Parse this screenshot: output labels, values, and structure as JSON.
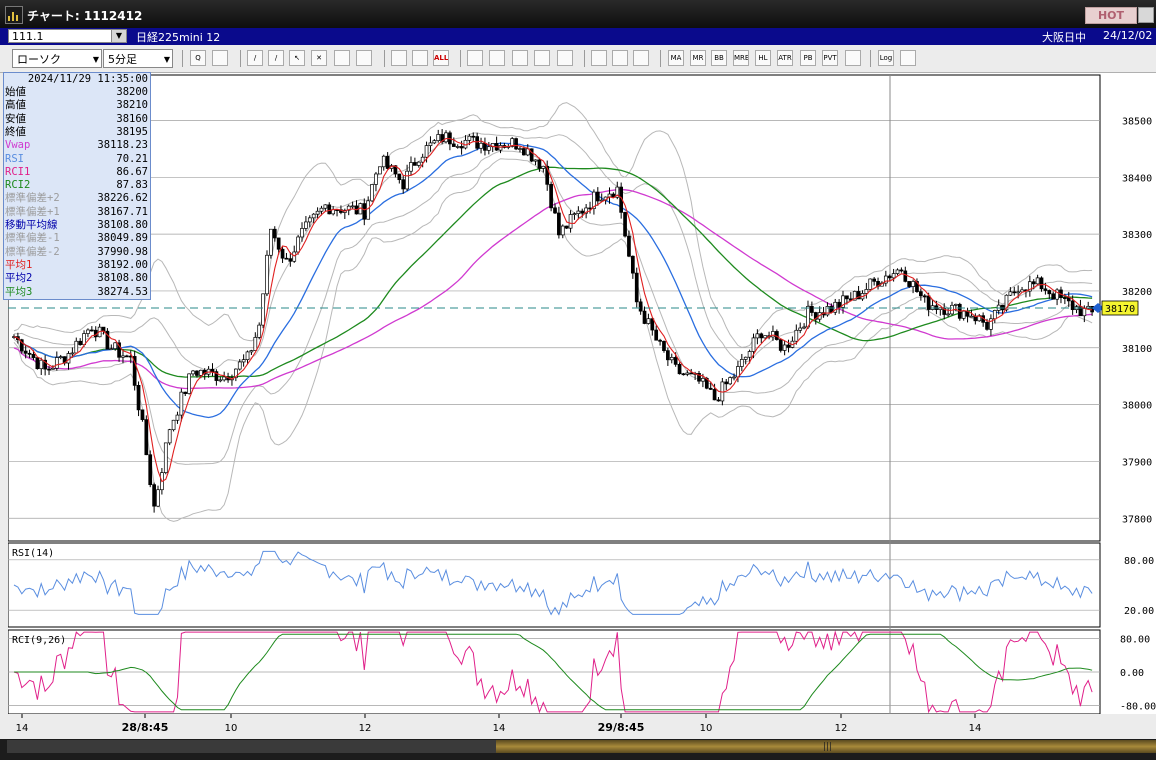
{
  "window": {
    "title": "チャート: 1112412",
    "hot_label": "HOT"
  },
  "infobar": {
    "symbol": "111.1",
    "product": "日経225mini 12",
    "market": "大阪日中",
    "date": "24/12/02"
  },
  "toolbar": {
    "chart_type": "ローソク",
    "interval": "5分足",
    "buttons": [
      {
        "name": "zoom-icon",
        "label": "Q"
      },
      {
        "name": "window-icon",
        "label": ""
      },
      {
        "name": "pencil-icon",
        "label": "/"
      },
      {
        "name": "line-draw-icon",
        "label": "/"
      },
      {
        "name": "cursor-icon",
        "label": "↖"
      },
      {
        "name": "erase-icon",
        "label": "✕"
      },
      {
        "name": "memo-icon",
        "label": ""
      },
      {
        "name": "trash-icon",
        "label": ""
      },
      {
        "name": "candle-add-icon",
        "label": ""
      },
      {
        "name": "candle-remove-icon",
        "label": ""
      },
      {
        "name": "all-button",
        "label": "ALL"
      },
      {
        "name": "volume-icon",
        "label": ""
      },
      {
        "name": "search-chart-icon",
        "label": ""
      },
      {
        "name": "panel-icon",
        "label": ""
      },
      {
        "name": "split-icon",
        "label": ""
      },
      {
        "name": "tick-icon",
        "label": ""
      },
      {
        "name": "settings-icon",
        "label": ""
      },
      {
        "name": "tools-icon",
        "label": ""
      },
      {
        "name": "color-icon",
        "label": ""
      },
      {
        "name": "ma-button",
        "label": "MA"
      },
      {
        "name": "mr-button",
        "label": "MR"
      },
      {
        "name": "bb-button",
        "label": "BB"
      },
      {
        "name": "mre-button",
        "label": "MRE"
      },
      {
        "name": "hl-button",
        "label": "HL"
      },
      {
        "name": "atr-button",
        "label": "ATR"
      },
      {
        "name": "pb-button",
        "label": "PB"
      },
      {
        "name": "pvt-button",
        "label": "PVT"
      },
      {
        "name": "frame-button",
        "label": ""
      },
      {
        "name": "log-button",
        "label": "Log"
      },
      {
        "name": "export-button",
        "label": ""
      }
    ]
  },
  "info_panel": {
    "timestamp": "2024/11/29 11:35:00",
    "rows": [
      {
        "label": "始値",
        "value": "38200",
        "color": "#000000"
      },
      {
        "label": "高値",
        "value": "38210",
        "color": "#000000"
      },
      {
        "label": "安値",
        "value": "38160",
        "color": "#000000"
      },
      {
        "label": "終値",
        "value": "38195",
        "color": "#000000"
      },
      {
        "label": "Vwap",
        "value": "38118.23",
        "color": "#d03ad0"
      },
      {
        "label": "RSI",
        "value": "70.21",
        "color": "#5a8ee0"
      },
      {
        "label": "RCI1",
        "value": "86.67",
        "color": "#e0208a"
      },
      {
        "label": "RCI2",
        "value": "87.83",
        "color": "#1e8a1e"
      },
      {
        "label": "標準偏差+2",
        "value": "38226.62",
        "color": "#9c9c9c"
      },
      {
        "label": "標準偏差+1",
        "value": "38167.71",
        "color": "#9c9c9c"
      },
      {
        "label": "移動平均線",
        "value": "38108.80",
        "color": "#0000aa"
      },
      {
        "label": "標準偏差-1",
        "value": "38049.89",
        "color": "#9c9c9c"
      },
      {
        "label": "標準偏差-2",
        "value": "37990.98",
        "color": "#9c9c9c"
      },
      {
        "label": "平均1",
        "value": "38192.00",
        "color": "#e02020"
      },
      {
        "label": "平均2",
        "value": "38108.80",
        "color": "#0000aa"
      },
      {
        "label": "平均3",
        "value": "38274.53",
        "color": "#1e8a1e"
      }
    ]
  },
  "price_axis": {
    "ticks": [
      "38500",
      "38400",
      "38300",
      "38200",
      "38100",
      "38000",
      "37900",
      "37800"
    ],
    "current_price": "38170"
  },
  "panels": {
    "rsi_label": "RSI(14)",
    "rsi_ticks": [
      "80.00",
      "20.00"
    ],
    "rci_label": "RCI(9,26)",
    "rci_ticks": [
      "80.00",
      "0.00",
      "-80.00"
    ]
  },
  "time_axis": {
    "labels": [
      "14",
      "28/8:45",
      "10",
      "12",
      "14",
      "29/8:45",
      "10",
      "12",
      "14"
    ]
  },
  "chart_data": {
    "type": "candlestick",
    "interval": "5分足",
    "ylim": [
      37760,
      38580
    ],
    "price_ticks": [
      38500,
      38400,
      38300,
      38200,
      38100,
      38000,
      37900,
      37800
    ],
    "current_price": 38170,
    "x_labels": [
      "14",
      "28/8:45",
      "10",
      "12",
      "14",
      "29/8:45",
      "10",
      "12",
      "14"
    ],
    "colors": {
      "up": "#ffffff",
      "down": "#000000",
      "ma_fast": "#e02020",
      "ma_mid": "#2a6ee0",
      "ma_slow": "#1e8a1e",
      "vwap": "#d03ad0",
      "bands": "#b8b8b8",
      "rsi": "#5a8ee0",
      "rci1": "#e0208a",
      "rci2": "#1e8a1e",
      "current": "#2a8a8a"
    },
    "price_anchors": [
      [
        0,
        38120
      ],
      [
        8,
        38060
      ],
      [
        14,
        38090
      ],
      [
        20,
        38140
      ],
      [
        25,
        38100
      ],
      [
        30,
        38080
      ],
      [
        33,
        37960
      ],
      [
        36,
        37820
      ],
      [
        40,
        37960
      ],
      [
        46,
        38060
      ],
      [
        54,
        38050
      ],
      [
        60,
        38080
      ],
      [
        63,
        38140
      ],
      [
        66,
        38310
      ],
      [
        70,
        38250
      ],
      [
        74,
        38300
      ],
      [
        80,
        38350
      ],
      [
        90,
        38340
      ],
      [
        94,
        38430
      ],
      [
        100,
        38390
      ],
      [
        104,
        38440
      ],
      [
        110,
        38470
      ],
      [
        120,
        38460
      ],
      [
        130,
        38460
      ],
      [
        136,
        38420
      ],
      [
        140,
        38300
      ],
      [
        144,
        38330
      ],
      [
        150,
        38370
      ],
      [
        155,
        38380
      ],
      [
        160,
        38180
      ],
      [
        166,
        38100
      ],
      [
        170,
        38060
      ],
      [
        176,
        38040
      ],
      [
        180,
        38010
      ],
      [
        186,
        38060
      ],
      [
        192,
        38130
      ],
      [
        198,
        38100
      ],
      [
        204,
        38160
      ],
      [
        210,
        38170
      ],
      [
        216,
        38190
      ],
      [
        222,
        38220
      ],
      [
        228,
        38240
      ],
      [
        234,
        38180
      ],
      [
        240,
        38170
      ],
      [
        246,
        38160
      ],
      [
        250,
        38140
      ],
      [
        254,
        38170
      ],
      [
        258,
        38210
      ],
      [
        264,
        38210
      ],
      [
        270,
        38180
      ],
      [
        276,
        38160
      ]
    ]
  }
}
